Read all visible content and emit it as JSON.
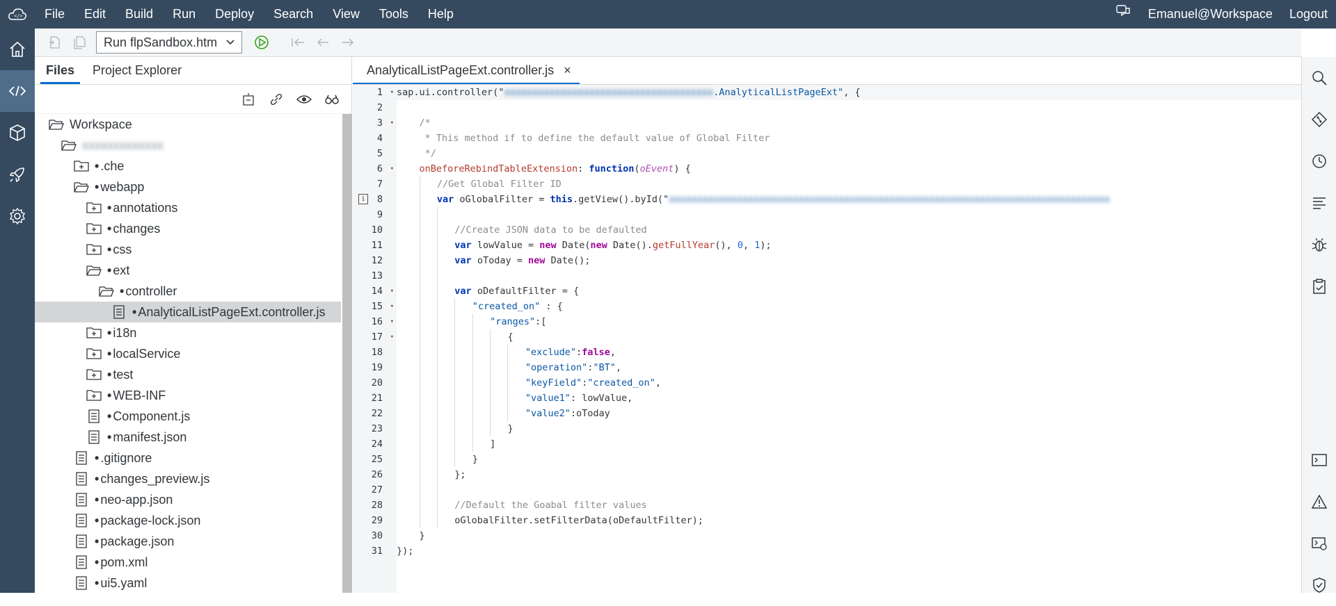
{
  "menubar": {
    "items": [
      "File",
      "Edit",
      "Build",
      "Run",
      "Deploy",
      "Search",
      "View",
      "Tools",
      "Help"
    ],
    "user": "Emanuel@Workspace",
    "logout": "Logout"
  },
  "toolbar": {
    "run_config": "Run flpSandbox.htm"
  },
  "files_panel": {
    "tabs": [
      "Files",
      "Project Explorer"
    ],
    "tree": [
      {
        "name": "Workspace",
        "indent": 0,
        "icon": "folder-open-icon",
        "dot": false
      },
      {
        "name": "xxxxxxxxxxxxx",
        "indent": 1,
        "icon": "folder-open-icon",
        "dot": false,
        "blurred": true
      },
      {
        "name": ".che",
        "indent": 2,
        "icon": "folder-plus-icon",
        "dot": true
      },
      {
        "name": "webapp",
        "indent": 2,
        "icon": "folder-open-icon",
        "dot": true
      },
      {
        "name": "annotations",
        "indent": 3,
        "icon": "folder-plus-icon",
        "dot": true
      },
      {
        "name": "changes",
        "indent": 3,
        "icon": "folder-plus-icon",
        "dot": true
      },
      {
        "name": "css",
        "indent": 3,
        "icon": "folder-plus-icon",
        "dot": true
      },
      {
        "name": "ext",
        "indent": 3,
        "icon": "folder-open-icon",
        "dot": true
      },
      {
        "name": "controller",
        "indent": 4,
        "icon": "folder-open-icon",
        "dot": true
      },
      {
        "name": "AnalyticalListPageExt.controller.js",
        "indent": 5,
        "icon": "file-icon",
        "dot": true,
        "selected": true
      },
      {
        "name": "i18n",
        "indent": 3,
        "icon": "folder-plus-icon",
        "dot": true
      },
      {
        "name": "localService",
        "indent": 3,
        "icon": "folder-plus-icon",
        "dot": true
      },
      {
        "name": "test",
        "indent": 3,
        "icon": "folder-plus-icon",
        "dot": true
      },
      {
        "name": "WEB-INF",
        "indent": 3,
        "icon": "folder-plus-icon",
        "dot": true
      },
      {
        "name": "Component.js",
        "indent": 3,
        "icon": "file-icon",
        "dot": true
      },
      {
        "name": "manifest.json",
        "indent": 3,
        "icon": "file-icon",
        "dot": true
      },
      {
        "name": ".gitignore",
        "indent": 2,
        "icon": "file-icon",
        "dot": true
      },
      {
        "name": "changes_preview.js",
        "indent": 2,
        "icon": "file-icon",
        "dot": true
      },
      {
        "name": "neo-app.json",
        "indent": 2,
        "icon": "file-icon",
        "dot": true
      },
      {
        "name": "package-lock.json",
        "indent": 2,
        "icon": "file-icon",
        "dot": true
      },
      {
        "name": "package.json",
        "indent": 2,
        "icon": "file-icon",
        "dot": true
      },
      {
        "name": "pom.xml",
        "indent": 2,
        "icon": "file-icon",
        "dot": true
      },
      {
        "name": "ui5.yaml",
        "indent": 2,
        "icon": "file-icon",
        "dot": true
      }
    ]
  },
  "editor": {
    "tab_label": "AnalyticalListPageExt.controller.js",
    "close_symbol": "×",
    "lines": [
      {
        "n": 1,
        "fold": true
      },
      {
        "n": 2
      },
      {
        "n": 3,
        "fold": true
      },
      {
        "n": 4
      },
      {
        "n": 5
      },
      {
        "n": 6,
        "fold": true
      },
      {
        "n": 7
      },
      {
        "n": 8,
        "info": true
      },
      {
        "n": 9
      },
      {
        "n": 10
      },
      {
        "n": 11
      },
      {
        "n": 12
      },
      {
        "n": 13
      },
      {
        "n": 14,
        "fold": true
      },
      {
        "n": 15,
        "fold": true
      },
      {
        "n": 16,
        "fold": true
      },
      {
        "n": 17,
        "fold": true
      },
      {
        "n": 18
      },
      {
        "n": 19
      },
      {
        "n": 20
      },
      {
        "n": 21
      },
      {
        "n": 22
      },
      {
        "n": 23
      },
      {
        "n": 24
      },
      {
        "n": 25
      },
      {
        "n": 26
      },
      {
        "n": 27
      },
      {
        "n": 28
      },
      {
        "n": 29
      },
      {
        "n": 30
      },
      {
        "n": 31
      }
    ],
    "code": {
      "l1_a": "sap.ui.controller(\"",
      "l1_blur": "xxxxxxxxxxxxxxxxxxxxxxxxxxxxxxxxxxxxx",
      "l1_b": ".AnalyticalListPageExt\"",
      "l1_c": ", {",
      "l3": "/*",
      "l4": " * This method if to define the default value of Global Filter",
      "l5": " */",
      "l6_a": "onBeforeRebindTableExtension",
      "l6_b": ": ",
      "l6_c": "function",
      "l6_d": "(",
      "l6_e": "oEvent",
      "l6_f": ") {",
      "l7": "//Get Global Filter ID",
      "l8_a": "var",
      "l8_b": " oGlobalFilter = ",
      "l8_c": "this",
      "l8_d": ".getView().byId(\"",
      "l8_blur": "xxxxxxxxxxxxxxxxxxxxxxxxxxxxxxxxxxxxxxxxxxxxxxxxxxxxxxxxxxxxxxxxxxxxxxxxxxxxxx",
      "l10": "//Create JSON data to be defaulted",
      "l11_a": "var",
      "l11_b": " lowValue = ",
      "l11_c": "new",
      "l11_d": " Date(",
      "l11_e": "new",
      "l11_f": " Date().",
      "l11_g": "getFullYear",
      "l11_h": "(), ",
      "l11_i": "0",
      "l11_j": ", ",
      "l11_k": "1",
      "l11_l": ");",
      "l12_a": "var",
      "l12_b": " oToday = ",
      "l12_c": "new",
      "l12_d": " Date();",
      "l14_a": "var",
      "l14_b": " oDefaultFilter = {",
      "l15_a": "\"created_on\"",
      "l15_b": " : {",
      "l16_a": "\"ranges\"",
      "l16_b": ":[",
      "l17": "{",
      "l18_a": "\"exclude\"",
      "l18_b": ":",
      "l18_c": "false",
      "l18_d": ",",
      "l19_a": "\"operation\"",
      "l19_b": ":",
      "l19_c": "\"BT\"",
      "l19_d": ",",
      "l20_a": "\"keyField\"",
      "l20_b": ":",
      "l20_c": "\"created_on\"",
      "l20_d": ",",
      "l21_a": "\"value1\"",
      "l21_b": ": lowValue,",
      "l22_a": "\"value2\"",
      "l22_b": ":oToday",
      "l23": "}",
      "l24": "]",
      "l25": "}",
      "l26": "};",
      "l28": "//Default the Goabal filter values",
      "l29": "oGlobalFilter.setFilterData(oDefaultFilter);",
      "l30": "}",
      "l31": "});"
    }
  }
}
